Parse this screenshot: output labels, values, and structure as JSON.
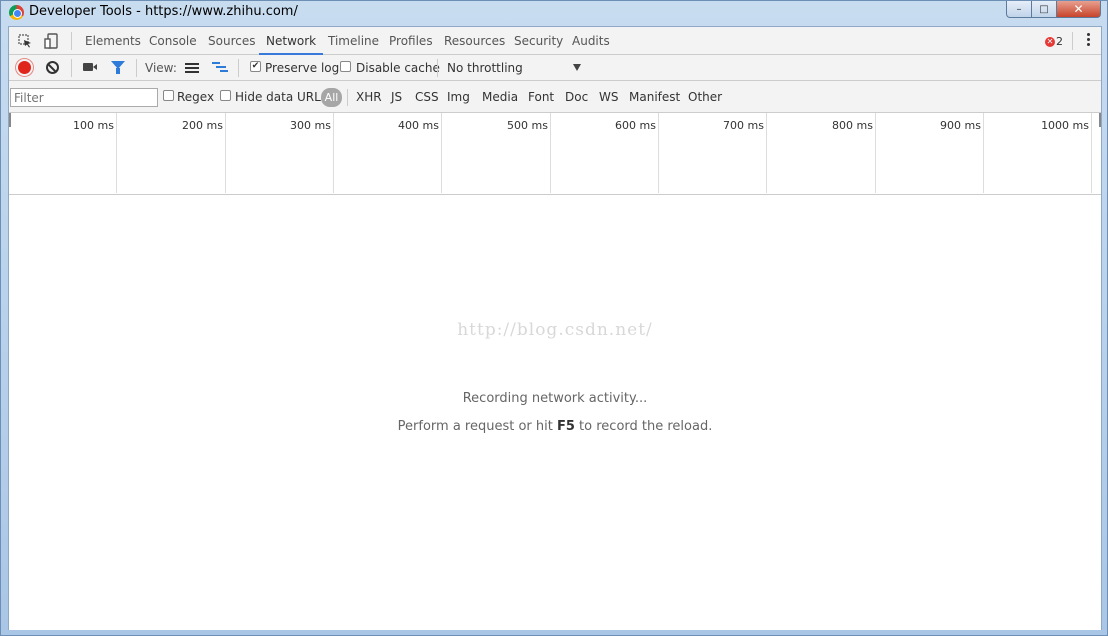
{
  "window": {
    "title": "Developer Tools - https://www.zhihu.com/",
    "controls": {
      "minimize": "–",
      "maximize": "□",
      "close": "✕"
    }
  },
  "panel_tabs": [
    {
      "label": "Elements"
    },
    {
      "label": "Console"
    },
    {
      "label": "Sources"
    },
    {
      "label": "Network",
      "active": true
    },
    {
      "label": "Timeline"
    },
    {
      "label": "Profiles"
    },
    {
      "label": "Resources"
    },
    {
      "label": "Security"
    },
    {
      "label": "Audits"
    }
  ],
  "errors": {
    "count": "2",
    "icon": "error-circle-icon"
  },
  "toolbar": {
    "view_label": "View:",
    "preserve_log": {
      "label": "Preserve log",
      "checked": true
    },
    "disable_cache": {
      "label": "Disable cache",
      "checked": false
    },
    "throttling": "No throttling"
  },
  "filterbar": {
    "filter_placeholder": "Filter",
    "regex": {
      "label": "Regex",
      "checked": false
    },
    "hide_data_urls": {
      "label": "Hide data URLs",
      "checked": false
    },
    "types": [
      "All",
      "XHR",
      "JS",
      "CSS",
      "Img",
      "Media",
      "Font",
      "Doc",
      "WS",
      "Manifest",
      "Other"
    ],
    "active_type": "All"
  },
  "timeline": {
    "ticks": [
      "100 ms",
      "200 ms",
      "300 ms",
      "400 ms",
      "500 ms",
      "600 ms",
      "700 ms",
      "800 ms",
      "900 ms",
      "1000 ms"
    ]
  },
  "empty_state": {
    "watermark": "http://blog.csdn.net/",
    "line1": "Recording network activity...",
    "line2_prefix": "Perform a request or hit ",
    "line2_key": "F5",
    "line2_suffix": " to record the reload."
  },
  "colors": {
    "accent": "#3879d9",
    "record": "#e0251b",
    "error": "#e53935"
  }
}
